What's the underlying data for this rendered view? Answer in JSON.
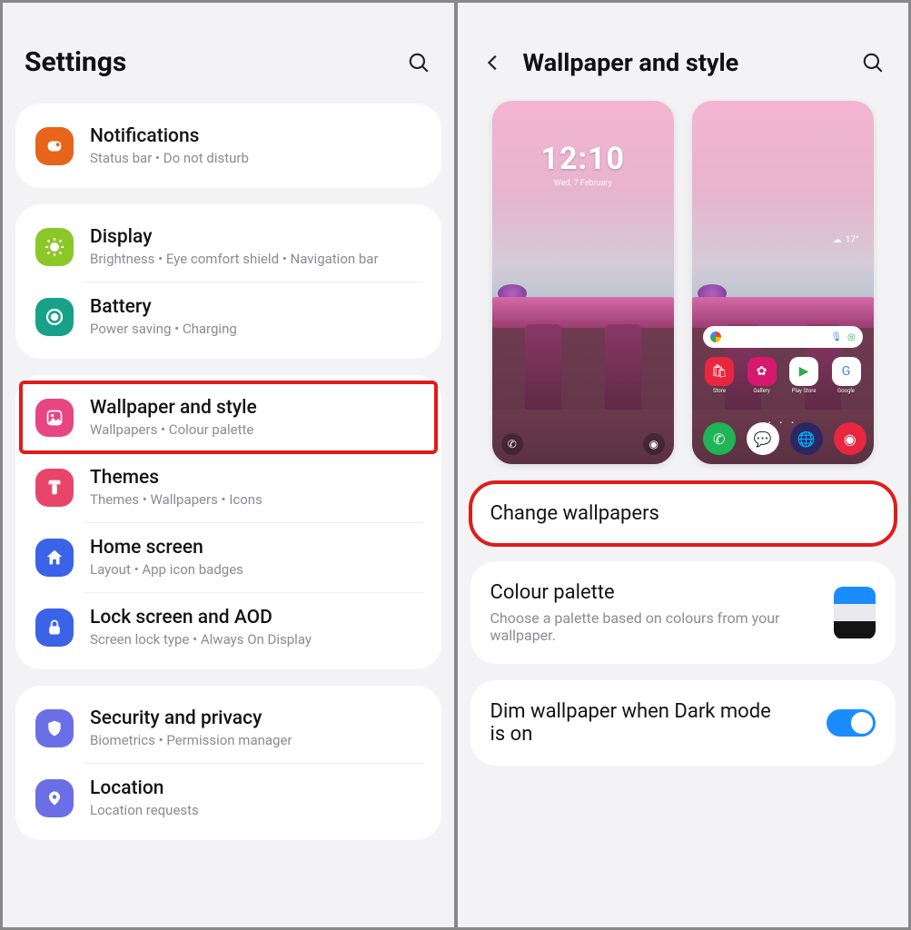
{
  "left": {
    "title": "Settings",
    "groups": [
      [
        {
          "icon": "notifications",
          "color": "#e7641b",
          "title": "Notifications",
          "sub": "Status bar  •  Do not disturb"
        }
      ],
      [
        {
          "icon": "display",
          "color": "#8bc827",
          "title": "Display",
          "sub": "Brightness  •  Eye comfort shield  •  Navigation bar"
        },
        {
          "icon": "battery",
          "color": "#17a188",
          "title": "Battery",
          "sub": "Power saving  •  Charging"
        }
      ],
      [
        {
          "icon": "wallpaper",
          "color": "#e84683",
          "title": "Wallpaper and style",
          "sub": "Wallpapers  •  Colour palette",
          "highlighted": true
        },
        {
          "icon": "themes",
          "color": "#e84669",
          "title": "Themes",
          "sub": "Themes  •  Wallpapers  •  Icons"
        },
        {
          "icon": "home",
          "color": "#3a63e8",
          "title": "Home screen",
          "sub": "Layout  •  App icon badges"
        },
        {
          "icon": "lock",
          "color": "#3a63e8",
          "title": "Lock screen and AOD",
          "sub": "Screen lock type  •  Always On Display"
        }
      ],
      [
        {
          "icon": "security",
          "color": "#6a6fe8",
          "title": "Security and privacy",
          "sub": "Biometrics  •  Permission manager"
        },
        {
          "icon": "location",
          "color": "#6a6fe8",
          "title": "Location",
          "sub": "Location requests"
        }
      ]
    ]
  },
  "right": {
    "title": "Wallpaper and style",
    "lock_preview": {
      "time": "12:10",
      "date": "Wed, 7 February"
    },
    "home_preview": {
      "weather_temp": "17°",
      "search_placeholder": "",
      "apps": [
        "Store",
        "Gallery",
        "Play Store",
        "Google"
      ],
      "dock": [
        "Phone",
        "Messages",
        "Internet",
        "Camera"
      ]
    },
    "change_wallpapers": "Change wallpapers",
    "palette_title": "Colour palette",
    "palette_sub": "Choose a palette based on colours from your wallpaper.",
    "palette_colors": [
      "#1a8cff",
      "#e9e9ee",
      "#141414"
    ],
    "dim_title": "Dim wallpaper when Dark mode is on",
    "dim_on": true
  }
}
